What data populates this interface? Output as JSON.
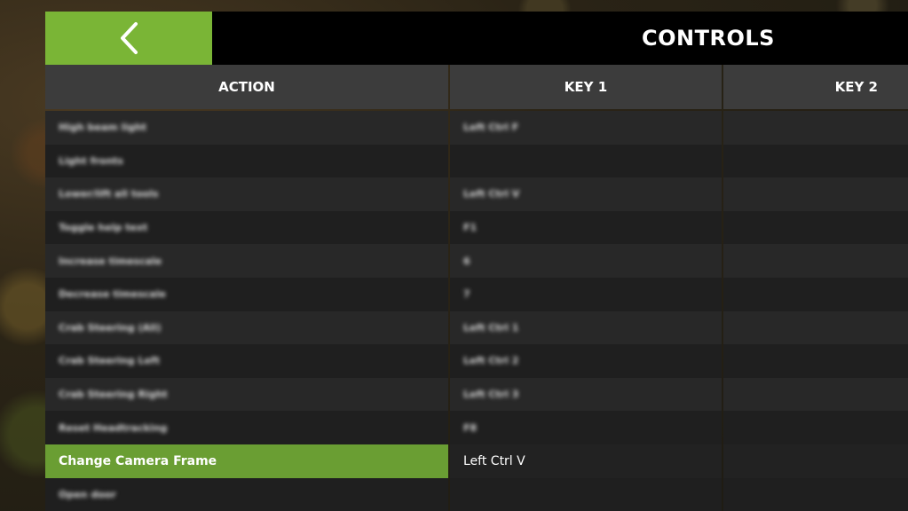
{
  "header": {
    "title": "CONTROLS",
    "back_icon": "chevron-left-icon"
  },
  "table": {
    "columns": [
      "ACTION",
      "KEY 1",
      "KEY 2"
    ],
    "rows": [
      {
        "action": "High beam light",
        "key1": "Left Ctrl F",
        "key2": ""
      },
      {
        "action": "Light fronts",
        "key1": "",
        "key2": ""
      },
      {
        "action": "Lower/lift all tools",
        "key1": "Left Ctrl V",
        "key2": ""
      },
      {
        "action": "Toggle help text",
        "key1": "F1",
        "key2": ""
      },
      {
        "action": "Increase timescale",
        "key1": "6",
        "key2": ""
      },
      {
        "action": "Decrease timescale",
        "key1": "7",
        "key2": ""
      },
      {
        "action": "Crab Steering (All)",
        "key1": "Left Ctrl 1",
        "key2": ""
      },
      {
        "action": "Crab Steering Left",
        "key1": "Left Ctrl 2",
        "key2": ""
      },
      {
        "action": "Crab Steering Right",
        "key1": "Left Ctrl 3",
        "key2": ""
      },
      {
        "action": "Reset Headtracking",
        "key1": "F8",
        "key2": ""
      },
      {
        "action": "Change Camera Frame",
        "key1": "Left Ctrl V",
        "key2": ""
      },
      {
        "action": "Open door",
        "key1": "",
        "key2": ""
      }
    ],
    "selected_index": 10
  },
  "colors": {
    "accent": "#7ab536",
    "selected_row": "#6a9e33",
    "header_bg": "#3c3c3c"
  }
}
